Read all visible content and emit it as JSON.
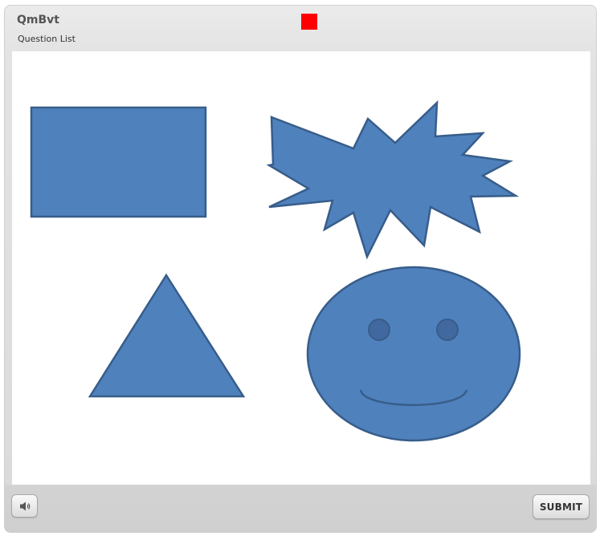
{
  "header": {
    "title": "QmBvt",
    "subtitle": "Question List"
  },
  "colors": {
    "shape_fill": "#4f81bd",
    "shape_stroke": "#385d8a",
    "eye_fill": "#41699f",
    "marker": "#ff0000"
  },
  "stage": {
    "shapes": [
      "rectangle",
      "explosion-star",
      "triangle",
      "smiley-face"
    ]
  },
  "footer": {
    "audio_icon": "speaker-icon",
    "submit_label": "SUBMIT"
  }
}
